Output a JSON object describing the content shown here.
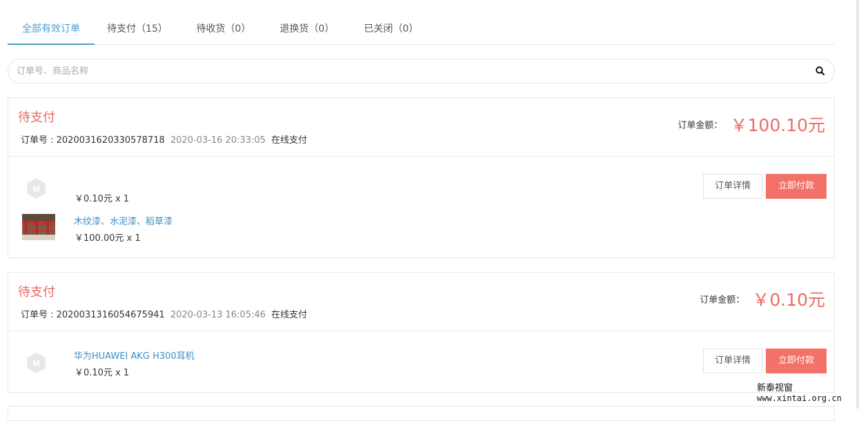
{
  "tabs": [
    {
      "label": "全部有效订单",
      "active": true
    },
    {
      "label": "待支付（15）",
      "active": false
    },
    {
      "label": "待收货（0）",
      "active": false
    },
    {
      "label": "退换货（0）",
      "active": false
    },
    {
      "label": "已关闭（0）",
      "active": false
    }
  ],
  "search": {
    "placeholder": "订单号、商品名称",
    "value": "",
    "icon": "search-icon"
  },
  "orders": [
    {
      "status": "待支付",
      "order_no_label": "订单号 : 2020031620330578718",
      "date": "2020-03-16 20:33:05",
      "payment": "在线支付",
      "amount_label": "订单金额：",
      "amount": "￥100.10元",
      "items": [
        {
          "name": "",
          "price": "￥0.10元 x 1",
          "thumb": "placeholder-m-logo"
        },
        {
          "name": "木纹漆、水泥漆、稻草漆",
          "price": "￥100.00元 x 1",
          "thumb": "red-railing-photo"
        }
      ],
      "detail_button": "订单详情",
      "pay_button": "立即付款"
    },
    {
      "status": "待支付",
      "order_no_label": "订单号 : 2020031316054675941",
      "date": "2020-03-13 16:05:46",
      "payment": "在线支付",
      "amount_label": "订单金额：",
      "amount": "￥0.10元",
      "items": [
        {
          "name": "华为HUAWEI AKG H300耳机",
          "price": "￥0.10元 x 1",
          "thumb": "placeholder-m-logo"
        }
      ],
      "detail_button": "订单详情",
      "pay_button": "立即付款"
    }
  ],
  "watermark": {
    "line1": "新泰视窗",
    "line2": "www.xintai.org.cn"
  },
  "colors": {
    "accent": "#4a9ed0",
    "status": "#e96a62",
    "price": "#ee6a66",
    "pay_button": "#f27168",
    "link": "#3b8fc4"
  }
}
